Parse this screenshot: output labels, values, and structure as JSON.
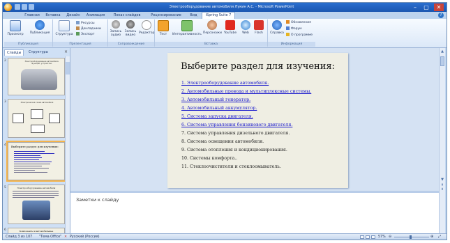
{
  "titlebar": {
    "title": "Электрооборудование автомобиля Лукин А.С. - Microsoft PowerPoint",
    "minimize": "–",
    "maximize": "▢",
    "close": "✕"
  },
  "tabs": [
    "Главная",
    "Вставка",
    "Дизайн",
    "Анимация",
    "Показ слайдов",
    "Рецензирование",
    "Вид",
    "iSpring Suite 7"
  ],
  "active_tab": "iSpring Suite 7",
  "ribbon": {
    "groups": {
      "publish": {
        "caption": "Публикация",
        "preview": "Просмотр",
        "publish": "Публикация"
      },
      "presentation": {
        "caption": "Презентация",
        "structure": "Структура",
        "resources": "Ресурсы",
        "speakers": "Докладчики",
        "export": "Экспорт"
      },
      "narration": {
        "caption": "Сопровождение",
        "record_audio_1": "Запись",
        "record_audio_2": "аудио",
        "record_video_1": "Запись",
        "record_video_2": "видео",
        "editor": "Редактор"
      },
      "insert": {
        "caption": "Вставка",
        "test": "Тест",
        "interactivity": "Интерактивность",
        "characters": "Персонажи",
        "youtube": "YouTube",
        "web": "Web",
        "flash": "Flash"
      },
      "info": {
        "caption": "Информация",
        "help": "Справка",
        "updates": "Обновления",
        "forum": "Форум",
        "about": "О программе"
      }
    }
  },
  "left_panel": {
    "tab_slides": "Слайды",
    "tab_outline": "Структура",
    "close": "×",
    "thumb_numbers": [
      "2",
      "3",
      "4",
      "5",
      "6"
    ],
    "thumb2_lines": [
      "Электрооборудование автомобиля. Функции, устройство."
    ],
    "thumb3_lines": [
      "Электрическая схема автомобиля"
    ],
    "thumb4_title": "Выберите раздел для изучения:",
    "thumb5_title": "Электрооборудование автомобиля",
    "thumb6_title": "Компоненты и автомобильные"
  },
  "slide": {
    "title": "Выберите раздел для изучения:",
    "items": [
      {
        "text": "1. Электрооборудование автомобиля.",
        "link": true
      },
      {
        "text": "2. Автомобильные провода и мультиплексные системы.",
        "link": true
      },
      {
        "text": "3. Автомобильный генератор.",
        "link": true
      },
      {
        "text": "4. Автомобильный аккумулятор.",
        "link": true
      },
      {
        "text": "5. Система запуска двигателя.",
        "link": true
      },
      {
        "text": "6. Система управления бензинового двигателя.",
        "link": true
      },
      {
        "text": "7. Система управления дизельного двигателя.",
        "link": false
      },
      {
        "text": "8. Система освещения автомобиля.",
        "link": false
      },
      {
        "text": "9. Система отопления и кондиционирования.",
        "link": false
      },
      {
        "text": "10. Системы комфорта..",
        "link": false
      },
      {
        "text": "11. Стеклоочистители и стеклоомыватель.",
        "link": false
      }
    ]
  },
  "notes": {
    "placeholder": "Заметки к слайду"
  },
  "statusbar": {
    "slide_count": "Слайд 3 из 107",
    "theme": "\"Тема Office\"",
    "language": "Русский (Россия)",
    "zoom": "57%"
  },
  "colors": {
    "link": "#1515cc",
    "ribbon_bg": "#dbe8f8",
    "titlebar": "#1a56b0",
    "slide_bg": "#efeee3"
  }
}
